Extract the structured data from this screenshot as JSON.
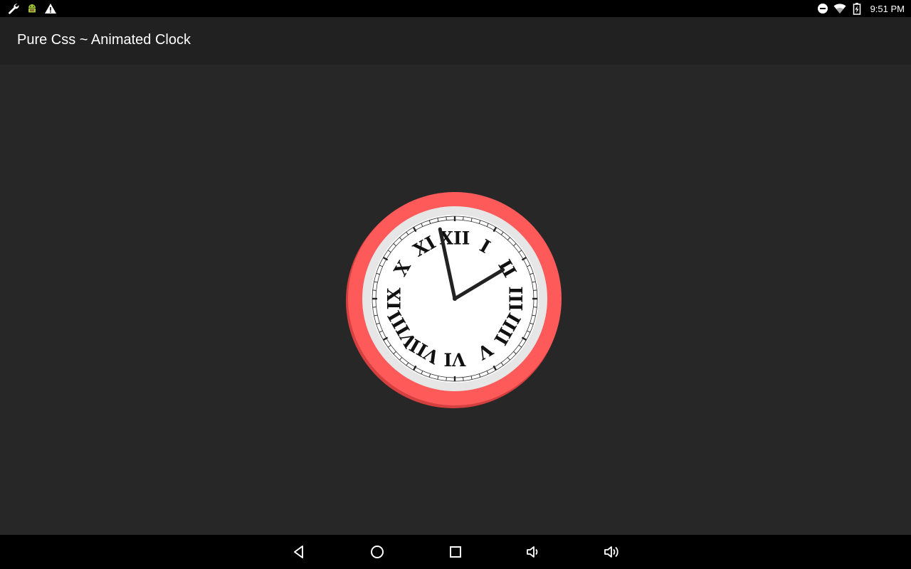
{
  "status_bar": {
    "time": "9:51 PM",
    "left_icons": [
      "wrench-icon",
      "android-debug-icon",
      "warning-icon"
    ],
    "right_icons": [
      "do-not-disturb-icon",
      "wifi-icon",
      "battery-icon"
    ]
  },
  "app_bar": {
    "title": "Pure Css ~ Animated Clock"
  },
  "clock": {
    "hour": 1,
    "minute": 58,
    "numerals": [
      "XII",
      "I",
      "II",
      "III",
      "IIII",
      "V",
      "VI",
      "VII",
      "VIII",
      "IX",
      "X",
      "XI"
    ],
    "colors": {
      "rim": "#ff5a5a",
      "rim_shadow": "#d44040",
      "face": "#ffffff",
      "bezel": "#e6e6e6",
      "hands": "#222222"
    }
  },
  "nav_bar": {
    "buttons": [
      "back-icon",
      "home-icon",
      "recents-icon",
      "volume-down-icon",
      "volume-up-icon"
    ]
  }
}
